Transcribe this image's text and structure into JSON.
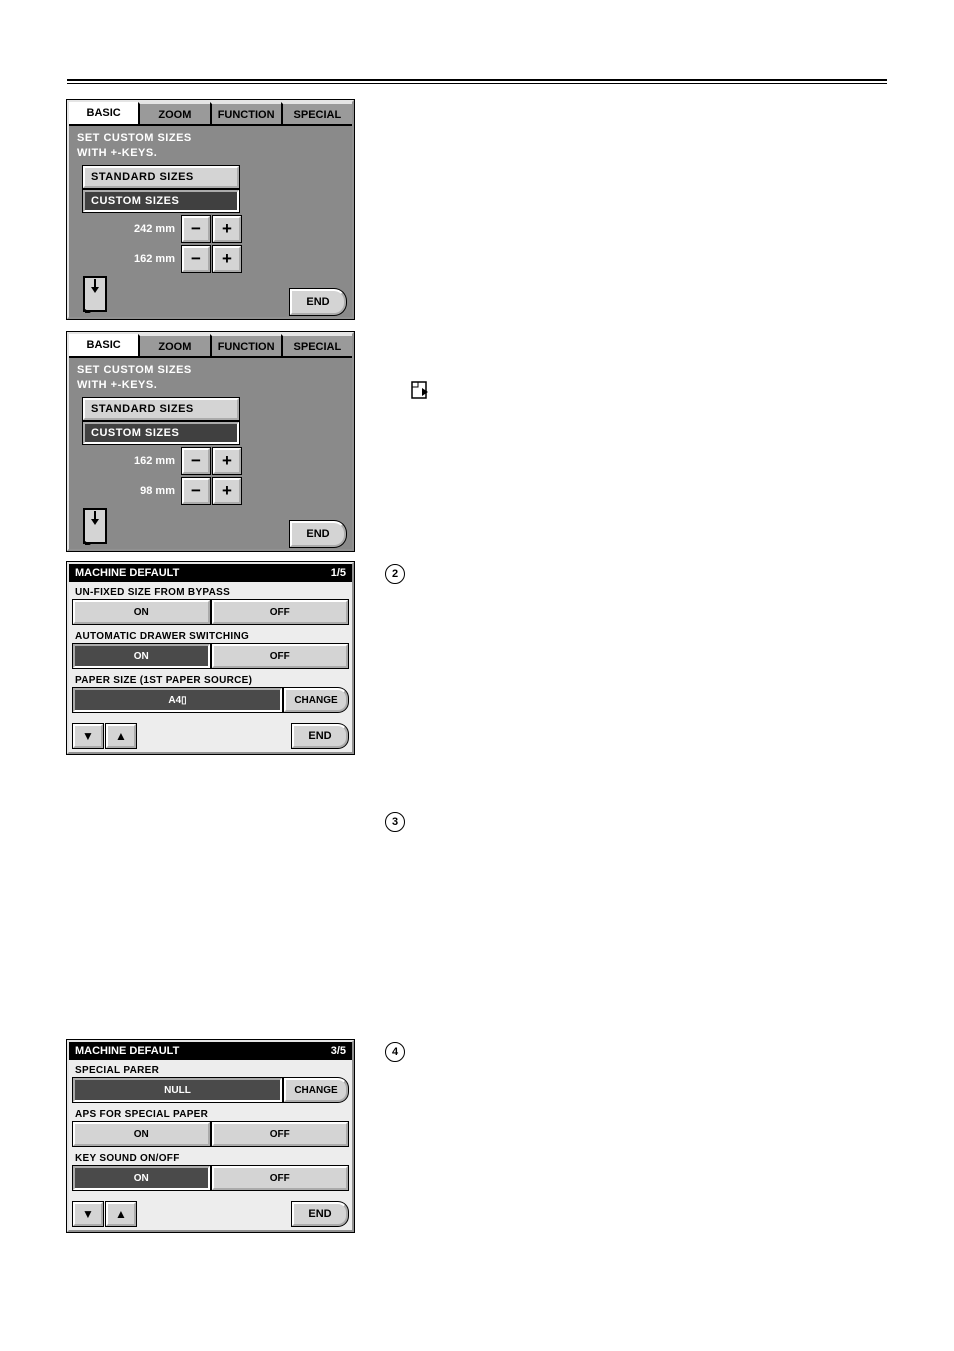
{
  "tabs": {
    "basic": "BASIC",
    "zoom": "ZOOM",
    "function": "FUNCTION",
    "special": "SPECIAL"
  },
  "panel1": {
    "instruction_l1": "SET CUSTOM SIZES",
    "instruction_l2": "WITH +-KEYS.",
    "btn_standard": "STANDARD SIZES",
    "btn_custom": "CUSTOM SIZES",
    "row1": "242 mm",
    "row2": "162 mm",
    "end": "END"
  },
  "panel2": {
    "instruction_l1": "SET CUSTOM SIZES",
    "instruction_l2": "WITH +-KEYS.",
    "btn_standard": "STANDARD SIZES",
    "btn_custom": "CUSTOM SIZES",
    "row1": "162 mm",
    "row2": "98 mm",
    "end": "END"
  },
  "md1": {
    "title": "MACHINE DEFAULT",
    "page": "1/5",
    "r1": "UN-FIXED SIZE FROM BYPASS",
    "on": "ON",
    "off": "OFF",
    "r2": "AUTOMATIC DRAWER SWITCHING",
    "r3": "PAPER SIZE (1ST PAPER SOURCE)",
    "r3val": "A4▯",
    "change": "CHANGE",
    "end": "END"
  },
  "md2": {
    "title": "MACHINE DEFAULT",
    "page": "3/5",
    "r1": "SPECIAL PARER",
    "r1val": "NULL",
    "change": "CHANGE",
    "r2": "APS FOR SPECIAL PAPER",
    "on": "ON",
    "off": "OFF",
    "r3": "KEY SOUND ON/OFF",
    "end": "END"
  },
  "notes": {
    "n2": "2",
    "n3": "3",
    "n4": "4"
  }
}
